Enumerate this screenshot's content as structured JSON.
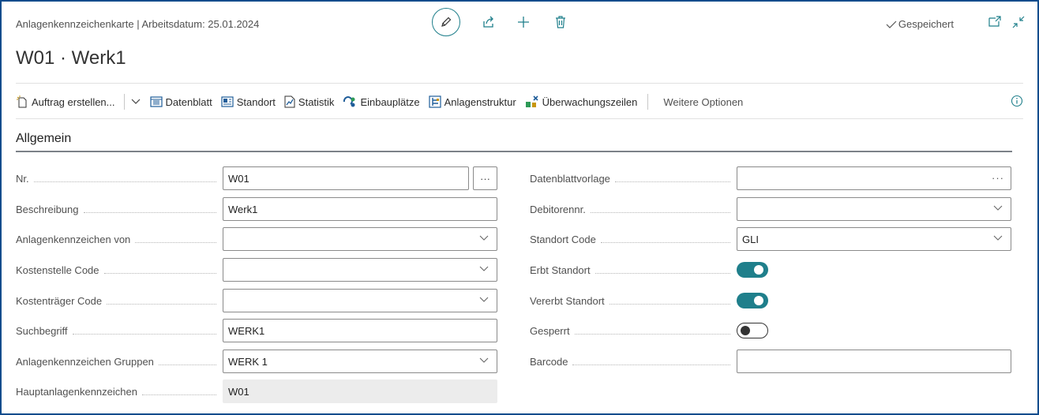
{
  "header": {
    "breadcrumb": "Anlagenkennzeichenkarte | Arbeitsdatum: 25.01.2024",
    "title": "W01 · Werk1",
    "saved_status": "Gespeichert"
  },
  "actions": {
    "auftrag": "Auftrag erstellen...",
    "datenblatt": "Datenblatt",
    "standort": "Standort",
    "statistik": "Statistik",
    "einbauplaetze": "Einbauplätze",
    "anlagenstruktur": "Anlagenstruktur",
    "ueberwachungszeilen": "Überwachungszeilen",
    "more": "Weitere Optionen"
  },
  "section": {
    "title": "Allgemein"
  },
  "fields_left": {
    "nr": {
      "label": "Nr.",
      "value": "W01"
    },
    "beschreibung": {
      "label": "Beschreibung",
      "value": "Werk1"
    },
    "anlagenkennzeichen_von": {
      "label": "Anlagenkennzeichen von",
      "value": ""
    },
    "kostenstelle": {
      "label": "Kostenstelle Code",
      "value": ""
    },
    "kostentraeger": {
      "label": "Kostenträger Code",
      "value": ""
    },
    "suchbegriff": {
      "label": "Suchbegriff",
      "value": "WERK1"
    },
    "gruppen": {
      "label": "Anlagenkennzeichen Gruppen",
      "value": "WERK 1"
    },
    "haupt": {
      "label": "Hauptanlagenkennzeichen",
      "value": "W01"
    }
  },
  "fields_right": {
    "datenblattvorlage": {
      "label": "Datenblattvorlage",
      "value": ""
    },
    "debitorennr": {
      "label": "Debitorennr.",
      "value": ""
    },
    "standort_code": {
      "label": "Standort Code",
      "value": "GLI"
    },
    "erbt_standort": {
      "label": "Erbt Standort",
      "on": true
    },
    "vererbt_standort": {
      "label": "Vererbt Standort",
      "on": true
    },
    "gesperrt": {
      "label": "Gesperrt",
      "on": false
    },
    "barcode": {
      "label": "Barcode",
      "value": ""
    }
  },
  "colors": {
    "accent": "#1f7f8b",
    "frame": "#0f4c8c"
  }
}
